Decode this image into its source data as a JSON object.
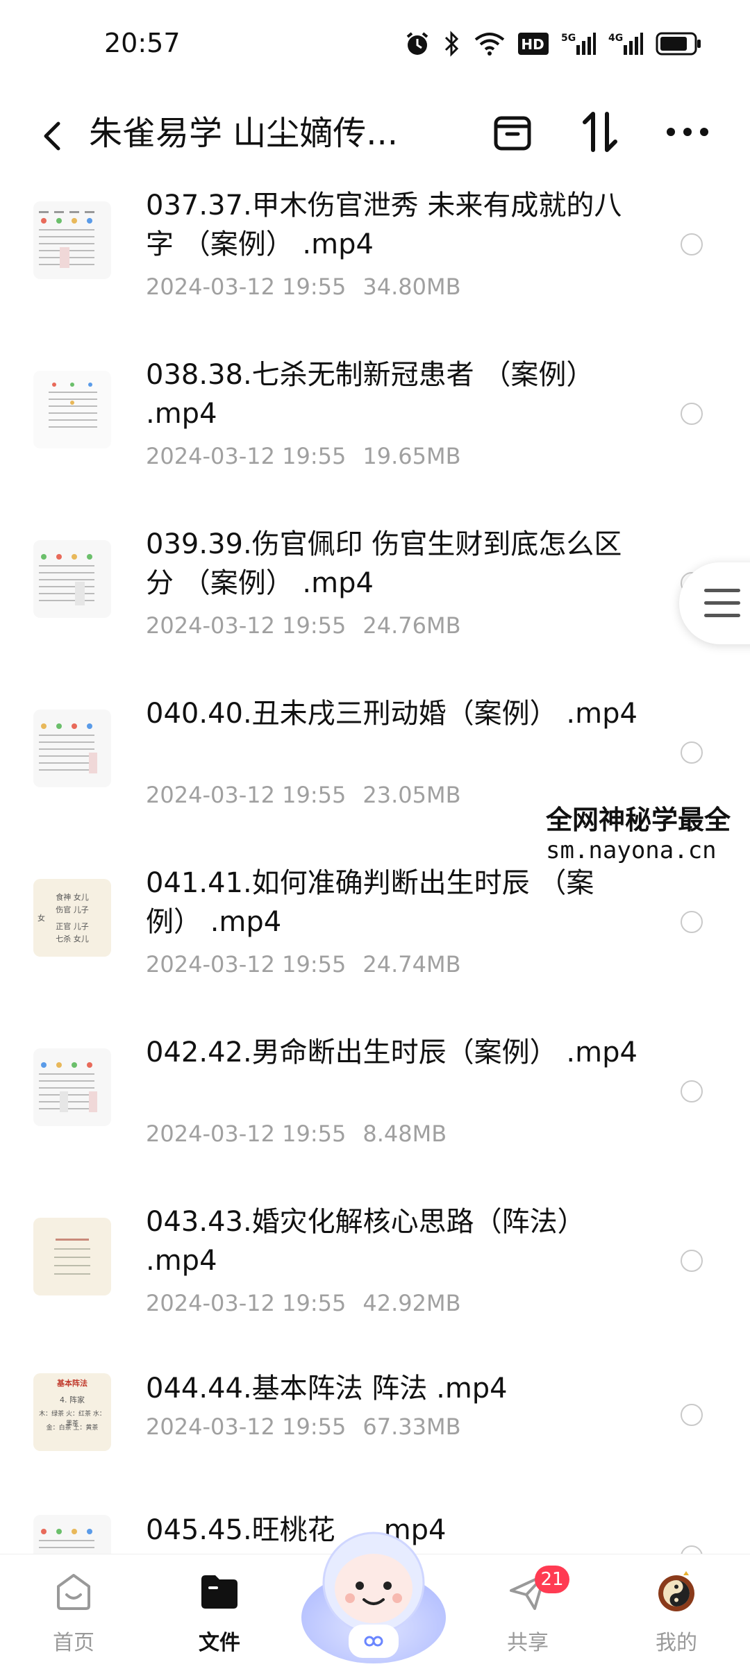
{
  "status_bar": {
    "time": "20:57",
    "icons": [
      "alarm-icon",
      "bluetooth-icon",
      "wifi-icon",
      "hd-icon",
      "signal-5g-icon",
      "signal-4g-icon",
      "battery-icon"
    ],
    "network_labels": [
      "HD",
      "5G",
      "4G"
    ]
  },
  "header": {
    "title": "朱雀易学 山尘嫡传...",
    "icons": [
      "back-icon",
      "archive-icon",
      "sort-icon",
      "more-icon"
    ]
  },
  "files": [
    {
      "name": "037.37.甲木伤官泄秀 未来有成就的八字 （案例） .mp4",
      "date": "2024-03-12  19:55",
      "size": "34.80MB"
    },
    {
      "name": "038.38.七杀无制新冠患者 （案例） .mp4",
      "date": "2024-03-12  19:55",
      "size": "19.65MB"
    },
    {
      "name": "039.39.伤官佩印 伤官生财到底怎么区分 （案例） .mp4",
      "date": "2024-03-12  19:55",
      "size": "24.76MB"
    },
    {
      "name": "040.40.丑未戌三刑动婚（案例） .mp4",
      "date": "2024-03-12  19:55",
      "size": "23.05MB"
    },
    {
      "name": "041.41.如何准确判断出生时辰 （案例） .mp4",
      "date": "2024-03-12  19:55",
      "size": "24.74MB"
    },
    {
      "name": "042.42.男命断出生时辰（案例） .mp4",
      "date": "2024-03-12  19:55",
      "size": "8.48MB"
    },
    {
      "name": "043.43.婚灾化解核心思路（阵法） .mp4",
      "date": "2024-03-12  19:55",
      "size": "42.92MB"
    },
    {
      "name": "044.44.基本阵法 阵法 .mp4",
      "date": "2024-03-12  19:55",
      "size": "67.33MB"
    },
    {
      "name": "045.45.旺桃花",
      "suffix": "mp4"
    }
  ],
  "thumb_text": {
    "t041": [
      "食神 女儿",
      "伤官 儿子",
      "女",
      "正官 儿子",
      "七杀 女儿"
    ],
    "t044": [
      "基本阵法",
      "4. 阵家",
      "木：绿茶 火：红茶 水：黑茶",
      "金：白茶 土：黄茶"
    ]
  },
  "watermark": {
    "line1": "全网神秘学最全",
    "line2": "sm.nayona.cn"
  },
  "bottom_nav": [
    {
      "label": "首页",
      "icon": "home-icon",
      "active": false
    },
    {
      "label": "文件",
      "icon": "folder-icon",
      "active": true
    },
    {
      "label": "共享",
      "icon": "share-icon",
      "active": false,
      "badge": "21"
    },
    {
      "label": "我的",
      "icon": "avatar-icon",
      "active": false
    }
  ]
}
